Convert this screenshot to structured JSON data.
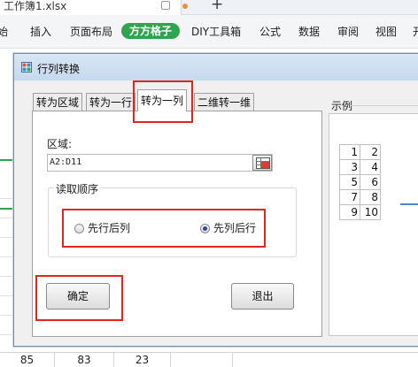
{
  "app": {
    "doc_title": "工作簿1.xlsx",
    "new_tab": "+",
    "menu": [
      "始",
      "插入",
      "页面布局",
      "方方格子",
      "DIY工具箱",
      "公式",
      "数据",
      "审阅",
      "视图",
      "开"
    ],
    "active_menu": "方方格子",
    "accent": "#2ea44f"
  },
  "sheet": {
    "bottom_row": [
      "85",
      "83",
      "23"
    ]
  },
  "dialog": {
    "title": "行列转换",
    "tabs": [
      "转为区域",
      "转为一行",
      "转为一列",
      "二维转一维"
    ],
    "selected_tab": "转为一列",
    "region_label": "区域:",
    "region_value": "A2:D11",
    "order_legend": "读取顺序",
    "radio_row_first": "先行后列",
    "radio_col_first": "先列后行",
    "selected_radio": "先列后行",
    "ok_label": "确定",
    "exit_label": "退出"
  },
  "example": {
    "label": "示例",
    "table": [
      [
        "1",
        "2"
      ],
      [
        "3",
        "4"
      ],
      [
        "5",
        "6"
      ],
      [
        "7",
        "8"
      ],
      [
        "9",
        "10"
      ]
    ]
  },
  "annotation_color": "#e0261f"
}
